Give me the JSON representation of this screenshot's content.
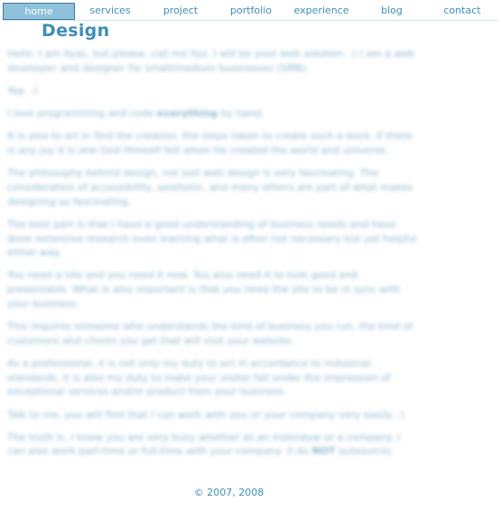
{
  "nav": {
    "items": [
      {
        "label": "home",
        "active": true
      },
      {
        "label": "services",
        "active": false
      },
      {
        "label": "project",
        "active": false
      },
      {
        "label": "portfolio",
        "active": false
      },
      {
        "label": "experience",
        "active": false
      },
      {
        "label": "blog",
        "active": false
      },
      {
        "label": "contact",
        "active": false
      }
    ]
  },
  "page": {
    "title": "Design"
  },
  "content": {
    "paragraphs": [
      {
        "text": "Hello. I am Ilyas, but please, call me Ilyz. I will be your web solution. :) I am a web developer and designer for small/medium businesses (SMB)."
      },
      {
        "text": "Yep. :)"
      },
      {
        "before": "I love programming and code ",
        "strong": "everything",
        "after": " by hand."
      },
      {
        "text": "It is also to art in find the creation, the steps taken to create such a work. If there is any joy it is one God Himself felt when He created the world and universe."
      },
      {
        "text": "The philosophy behind design, not just web design is very fascinating. The consideration of accessibility, aesthetic, and many others are part of what makes designing so fascinating."
      },
      {
        "text": "The best part is that I have a good understanding of business needs and have done extensive research even learning what is often not necessary but yet helpful either way."
      },
      {
        "text": "You need a site and you need it now. You also need it to look good and presentable. What is also important is that you need the site to be in sync with your business."
      },
      {
        "text": "This requires someone who understands the kind of business you run, the kind of customers and clients you get that will visit your website."
      },
      {
        "text": "As a professional, it is not only my duty to act in accordance to industrial standards, it is also my duty to make your visitor fall under the impression of exceptional services and/or product from your business."
      },
      {
        "text": "Talk to me, you will find that I can work with you or your company very easily. :)"
      },
      {
        "before": "The truth is, I know you are very busy whether as an individual or a company. I can also work part-time or full-time with your company. (I do ",
        "strong": "NOT",
        "after": " outsource)"
      }
    ]
  },
  "footer": {
    "text": "© 2007, 2008"
  }
}
